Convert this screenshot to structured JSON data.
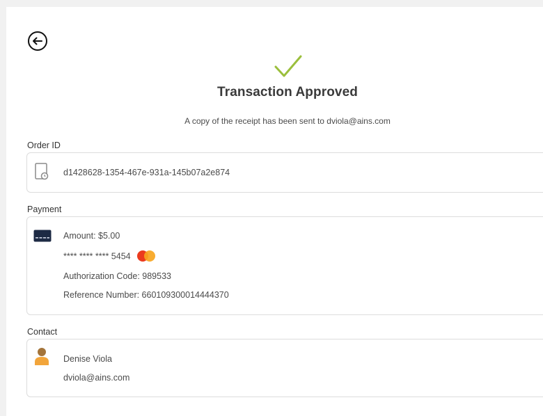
{
  "header": {
    "back_icon": "arrow-left-circle-icon",
    "status_icon": "checkmark-icon",
    "title": "Transaction Approved",
    "receipt_message": "A copy of the receipt has been sent to dviola@ains.com"
  },
  "order": {
    "label": "Order ID",
    "icon": "receipt-document-icon",
    "id": "d1428628-1354-467e-931a-145b07a2e874"
  },
  "payment": {
    "label": "Payment",
    "icon": "credit-card-icon",
    "amount": "Amount: $5.00",
    "card_number": "**** **** **** 5454",
    "card_brand_icon": "mastercard-logo-icon",
    "authorization": "Authorization Code: 989533",
    "reference": "Reference Number: 660109300014444370"
  },
  "contact": {
    "label": "Contact",
    "icon": "person-avatar-icon",
    "name": "Denise Viola",
    "email": "dviola@ains.com"
  },
  "colors": {
    "check_green": "#9bbf3c",
    "card_navy": "#1d2a44",
    "avatar_orange": "#f2a53b",
    "mastercard_red": "#eb3b1e",
    "mastercard_yellow": "#f7a51f"
  }
}
